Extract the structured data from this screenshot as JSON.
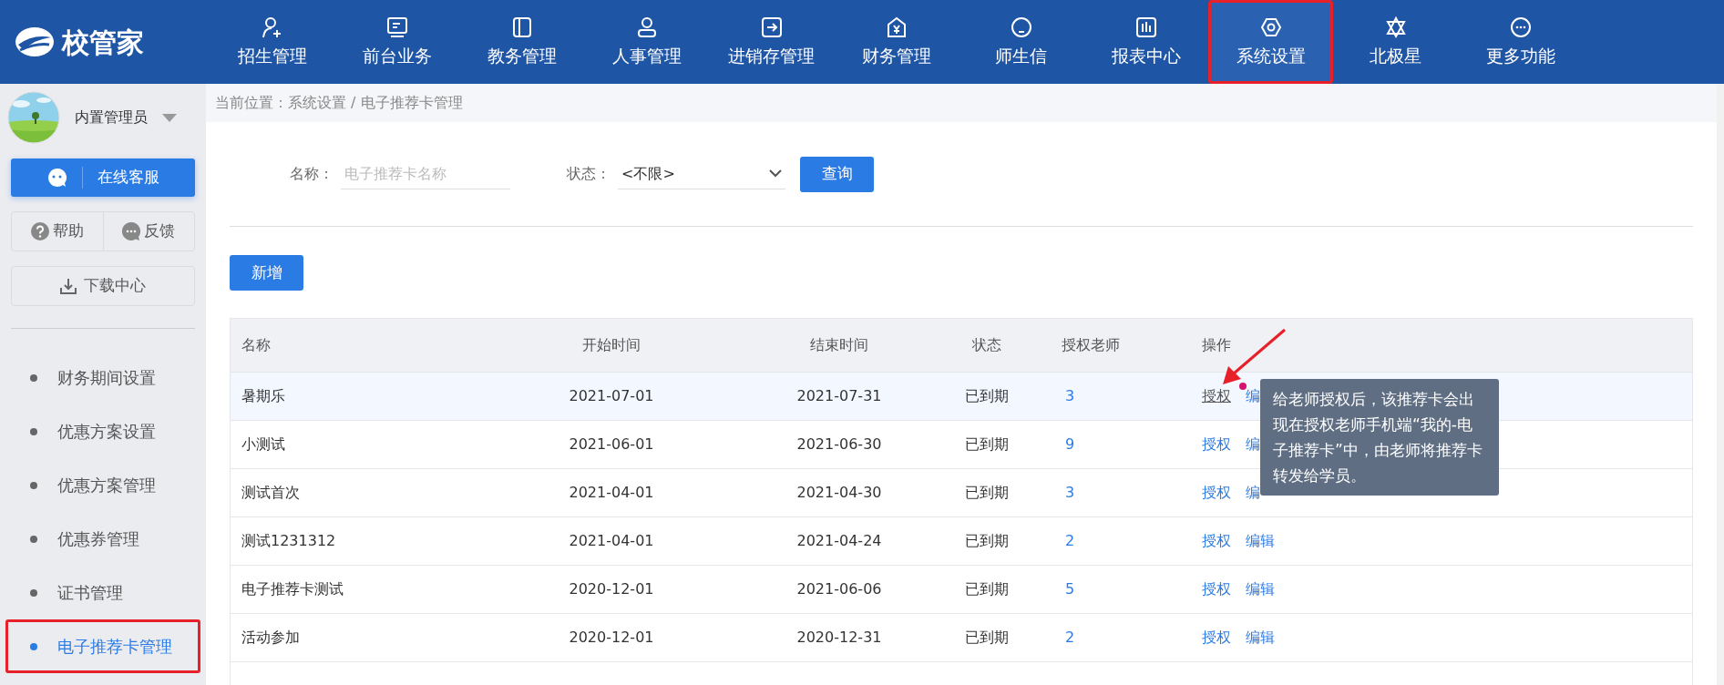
{
  "logo": {
    "text": "校管家"
  },
  "nav": [
    {
      "label": "招生管理",
      "selected": false,
      "highlighted": false
    },
    {
      "label": "前台业务",
      "selected": false,
      "highlighted": false
    },
    {
      "label": "教务管理",
      "selected": false,
      "highlighted": false
    },
    {
      "label": "人事管理",
      "selected": false,
      "highlighted": false
    },
    {
      "label": "进销存管理",
      "selected": false,
      "highlighted": false
    },
    {
      "label": "财务管理",
      "selected": false,
      "highlighted": false
    },
    {
      "label": "师生信",
      "selected": false,
      "highlighted": false
    },
    {
      "label": "报表中心",
      "selected": false,
      "highlighted": false
    },
    {
      "label": "系统设置",
      "selected": true,
      "highlighted": true
    },
    {
      "label": "北极星",
      "selected": false,
      "highlighted": false
    },
    {
      "label": "更多功能",
      "selected": false,
      "highlighted": false
    }
  ],
  "sidebar": {
    "user": "内置管理员",
    "service_button": "在线客服",
    "help": "帮助",
    "feedback": "反馈",
    "download": "下载中心",
    "items": [
      {
        "label": "财务期间设置",
        "selected": false,
        "highlighted": false
      },
      {
        "label": "优惠方案设置",
        "selected": false,
        "highlighted": false
      },
      {
        "label": "优惠方案管理",
        "selected": false,
        "highlighted": false
      },
      {
        "label": "优惠券管理",
        "selected": false,
        "highlighted": false
      },
      {
        "label": "证书管理",
        "selected": false,
        "highlighted": false
      },
      {
        "label": "电子推荐卡管理",
        "selected": true,
        "highlighted": true
      }
    ]
  },
  "breadcrumb": "当前位置：系统设置 / 电子推荐卡管理",
  "filters": {
    "name_label": "名称：",
    "name_placeholder": "电子推荐卡名称",
    "status_label": "状态：",
    "status_value": "<不限>",
    "query_button": "查询"
  },
  "add_button": "新增",
  "table": {
    "columns": [
      "名称",
      "开始时间",
      "结束时间",
      "状态",
      "授权老师",
      "操作"
    ],
    "rows": [
      {
        "name": "暑期乐",
        "start": "2021-07-01",
        "end": "2021-07-31",
        "status": "已到期",
        "teachers": "3",
        "actions": [
          "授权",
          "编"
        ],
        "hovered": true
      },
      {
        "name": "小测试",
        "start": "2021-06-01",
        "end": "2021-06-30",
        "status": "已到期",
        "teachers": "9",
        "actions": [
          "授权",
          "编"
        ],
        "hovered": false
      },
      {
        "name": "测试首次",
        "start": "2021-04-01",
        "end": "2021-04-30",
        "status": "已到期",
        "teachers": "3",
        "actions": [
          "授权",
          "编"
        ],
        "hovered": false
      },
      {
        "name": "测试1231312",
        "start": "2021-04-01",
        "end": "2021-04-24",
        "status": "已到期",
        "teachers": "2",
        "actions": [
          "授权",
          "编辑"
        ],
        "hovered": false
      },
      {
        "name": "电子推荐卡测试",
        "start": "2020-12-01",
        "end": "2021-06-06",
        "status": "已到期",
        "teachers": "5",
        "actions": [
          "授权",
          "编辑"
        ],
        "hovered": false
      },
      {
        "name": "活动参加",
        "start": "2020-12-01",
        "end": "2020-12-31",
        "status": "已到期",
        "teachers": "2",
        "actions": [
          "授权",
          "编辑"
        ],
        "hovered": false
      }
    ]
  },
  "tooltip": "给老师授权后，该推荐卡会出现在授权老师手机端“我的-电子推荐卡”中，由老师将推荐卡转发给学员。"
}
